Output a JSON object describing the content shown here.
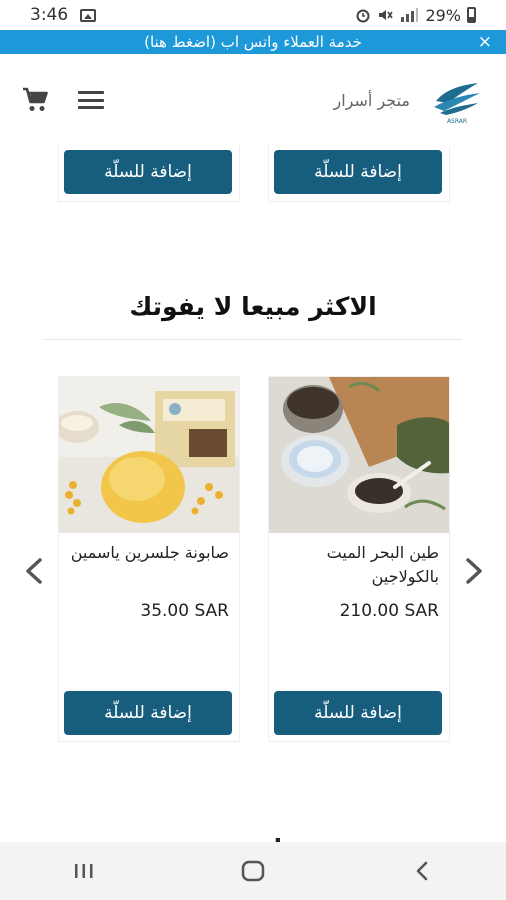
{
  "status_bar": {
    "time": "3:46",
    "battery_text": "29%",
    "icons": [
      "image-icon",
      "alarm-icon",
      "mute-icon",
      "signal-icon",
      "battery-icon"
    ]
  },
  "promo_bar": {
    "text": "خدمة العملاء واتس اب (اضغط هنا)",
    "close_label": "×",
    "background": "#1d98d8"
  },
  "header": {
    "store_name": "متجر أسرار",
    "logo_text": "ASRAR",
    "icons": [
      "cart-icon",
      "menu-icon"
    ]
  },
  "top_products": [
    {
      "button_label": "إضافة للسلّة"
    },
    {
      "button_label": "إضافة للسلّة"
    }
  ],
  "best_sellers": {
    "title": "الاكثر مبيعا لا يفوتك",
    "products": [
      {
        "name": "طين البحر الميت بالكولاجين",
        "price": "210.00 SAR",
        "button_label": "إضافة للسلّة"
      },
      {
        "name": "صابونة جلسرين ياسمين",
        "price": "35.00 SAR",
        "button_label": "إضافة للسلّة"
      }
    ]
  },
  "next_section": {
    "partial_title": "منتجات مميزة"
  },
  "theme": {
    "button_color": "#175e7e",
    "accent": "#1d98d8"
  }
}
